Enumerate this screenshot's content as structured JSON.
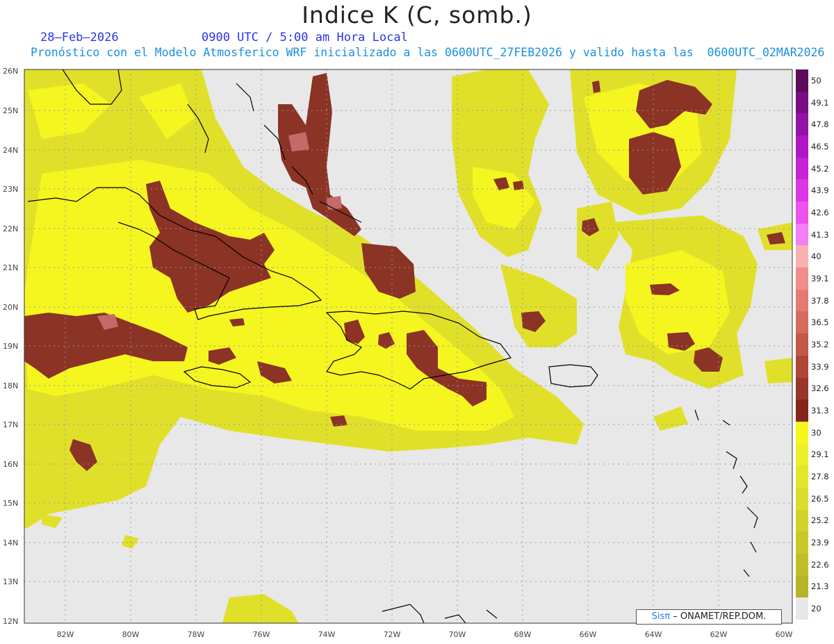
{
  "title": "Indice K (C, somb.)",
  "date": "28–Feb–2026",
  "time": "0900 UTC / 5:00 am Hora Local",
  "forecast_line": "Pronóstico con el Modelo Atmosferico WRF inicializado a las 0600UTC_27FEB2026 y valido hasta las  0600UTC_02MAR2026",
  "lat_labels": [
    "26N",
    "25N",
    "24N",
    "23N",
    "22N",
    "21N",
    "20N",
    "19N",
    "18N",
    "17N",
    "16N",
    "15N",
    "14N",
    "13N",
    "12N"
  ],
  "lon_labels": [
    "82W",
    "80W",
    "78W",
    "76W",
    "74W",
    "72W",
    "70W",
    "68W",
    "66W",
    "64W",
    "62W",
    "60W"
  ],
  "colorbar": {
    "labels": [
      "50",
      "49.1",
      "47.8",
      "46.5",
      "45.2",
      "43.9",
      "42.6",
      "41.3",
      "40",
      "39.1",
      "37.8",
      "36.5",
      "35.2",
      "33.9",
      "32.6",
      "31.3",
      "30",
      "29.1",
      "27.8",
      "26.5",
      "25.2",
      "23.9",
      "22.6",
      "21.3",
      "20"
    ],
    "colors": [
      "#5e0b59",
      "#7b0d86",
      "#9312a8",
      "#ae18c3",
      "#c723d7",
      "#dc35e3",
      "#ec52ee",
      "#f47ef3",
      "#f8b0b3",
      "#f28c8a",
      "#e47a70",
      "#d66a5c",
      "#c45847",
      "#b04637",
      "#993629",
      "#83271c",
      "#f6f61c",
      "#ecef2a",
      "#e4e62c",
      "#dbdc2b",
      "#d2d22a",
      "#c8c829",
      "#bfbe28",
      "#b6b427",
      "#e8e8e8"
    ]
  },
  "credit": {
    "logo": "Sisπ",
    "text": "– ONAMET/REP.DOM."
  },
  "colors": {
    "background": "#e8e8e8",
    "low": "#e2e229",
    "mid": "#f3f31f",
    "high": "#8b3324",
    "peak": "#c56a6a",
    "coast": "#000000"
  }
}
